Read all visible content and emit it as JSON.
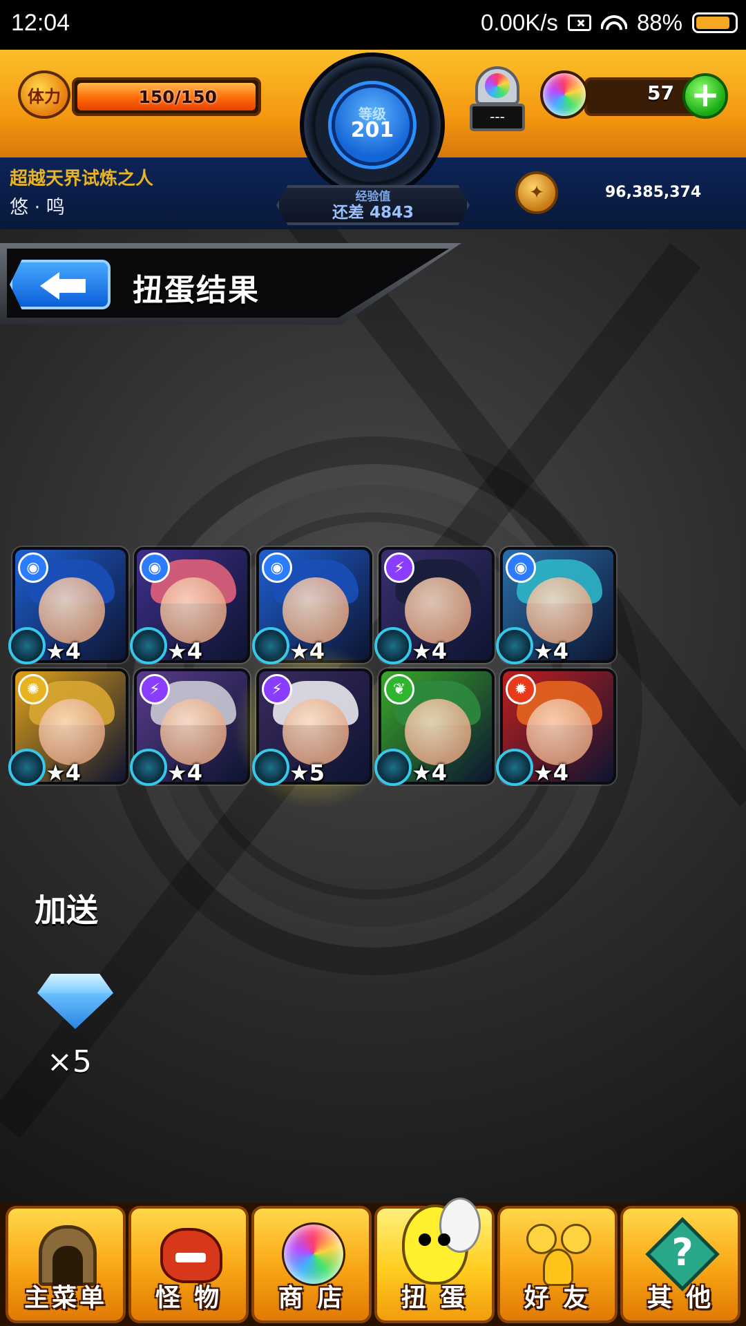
{
  "status_bar": {
    "time": "12:04",
    "network_speed": "0.00K/s",
    "battery": "88%",
    "battery_level": 0.88
  },
  "hud": {
    "stamina_icon_text": "体力",
    "stamina": "150/150",
    "stamina_fraction": 1.0,
    "level_label": "等级",
    "level": "201",
    "exp_label": "经验值",
    "exp_remaining": "还差 4843",
    "gacha_machine_display": "---",
    "orb_count": "57",
    "add_label": "+",
    "player_title": "超越天界试炼之人",
    "player_name": "悠 · 鸣",
    "coins": "96,385,374",
    "colors": {
      "orange": "#f59a12",
      "navy": "#0d2458"
    }
  },
  "page": {
    "title": "扭蛋结果",
    "bonus_label": "加送",
    "bonus_gem_count": "×5"
  },
  "results": [
    {
      "stars": "★4",
      "attribute": "water",
      "attr_icon": "water-drop-icon",
      "bg": "#1f5fd1",
      "hair": "#1a4fb8"
    },
    {
      "stars": "★4",
      "attribute": "water",
      "attr_icon": "water-drop-icon",
      "bg": "#3f2f8a",
      "hair": "#e0607a"
    },
    {
      "stars": "★4",
      "attribute": "water",
      "attr_icon": "water-drop-icon",
      "bg": "#1f5fd1",
      "hair": "#1a4fb8"
    },
    {
      "stars": "★4",
      "attribute": "dark",
      "attr_icon": "dark-bolt-icon",
      "bg": "#3a2f6e",
      "hair": "#1a1d3a"
    },
    {
      "stars": "★4",
      "attribute": "water",
      "attr_icon": "water-drop-icon",
      "bg": "#2a6fa8",
      "hair": "#2fb5c8"
    },
    {
      "stars": "★4",
      "attribute": "light",
      "attr_icon": "light-sun-icon",
      "bg": "#e0a21a",
      "hair": "#d8a632"
    },
    {
      "stars": "★4",
      "attribute": "dark",
      "attr_icon": "dark-bolt-icon",
      "bg": "#5a3c8a",
      "hair": "#c9c9d4"
    },
    {
      "stars": "★5",
      "attribute": "dark",
      "attr_icon": "dark-bolt-icon",
      "bg": "#3c2a5e",
      "hair": "#e8e8ee",
      "highlight": true
    },
    {
      "stars": "★4",
      "attribute": "wood",
      "attr_icon": "wood-leaf-icon",
      "bg": "#3aa82a",
      "hair": "#2d8a3e"
    },
    {
      "stars": "★4",
      "attribute": "fire",
      "attr_icon": "fire-flame-icon",
      "bg": "#c01f1f",
      "hair": "#e5651f"
    }
  ],
  "nav": {
    "items": [
      {
        "label": "主菜单",
        "icon": "home-gate-icon"
      },
      {
        "label": "怪 物",
        "icon": "monster-icon"
      },
      {
        "label": "商 店",
        "icon": "orb-shop-icon"
      },
      {
        "label": "扭 蛋",
        "icon": "egg-gacha-icon",
        "active": true
      },
      {
        "label": "好 友",
        "icon": "friends-icon"
      },
      {
        "label": "其 他",
        "icon": "question-icon"
      }
    ]
  }
}
